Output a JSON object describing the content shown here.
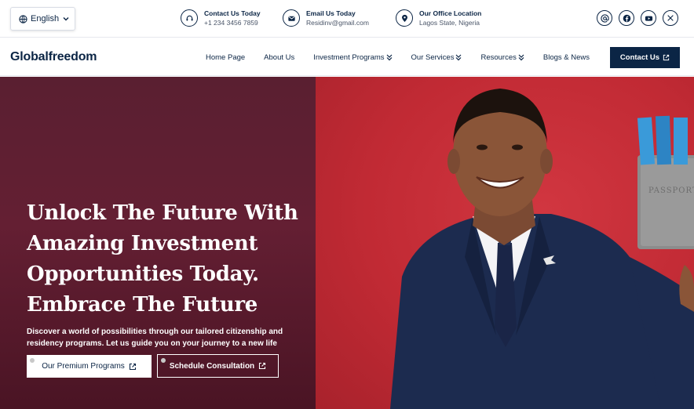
{
  "topbar": {
    "language": "English",
    "contacts": [
      {
        "title": "Contact Us Today",
        "value": "+1 234 3456 7859",
        "icon": "headset-icon"
      },
      {
        "title": "Email Us Today",
        "value": "Residinv@gmail.com",
        "icon": "envelope-icon"
      },
      {
        "title": "Our Office Location",
        "value": "Lagos State, Nigeria",
        "icon": "map-pin-icon"
      }
    ],
    "socials": [
      "at-sign-icon",
      "facebook-icon",
      "youtube-icon",
      "x-icon"
    ]
  },
  "nav": {
    "logo": "Globalfreedom",
    "items": [
      {
        "label": "Home Page",
        "dropdown": false
      },
      {
        "label": "About Us",
        "dropdown": false
      },
      {
        "label": "Investment Programs",
        "dropdown": true
      },
      {
        "label": "Our Services",
        "dropdown": true
      },
      {
        "label": "Resources",
        "dropdown": true
      },
      {
        "label": "Blogs & News",
        "dropdown": false
      }
    ],
    "contact_button": "Contact Us"
  },
  "hero": {
    "headline_lines": [
      "Unlock The Future With",
      "Amazing Investment",
      "Opportunities Today.",
      "Embrace The Future"
    ],
    "subtext": "Discover a world of possibilities through our tailored citizenship and residency programs. Let us guide you on your journey to a new life",
    "primary_button": "Our Premium Programs",
    "secondary_button": "Schedule Consultation",
    "passport_label": "PASSPORT"
  },
  "colors": {
    "navy": "#0b2545",
    "hero_left": "#5a1f31",
    "hero_right": "#c12a34"
  }
}
